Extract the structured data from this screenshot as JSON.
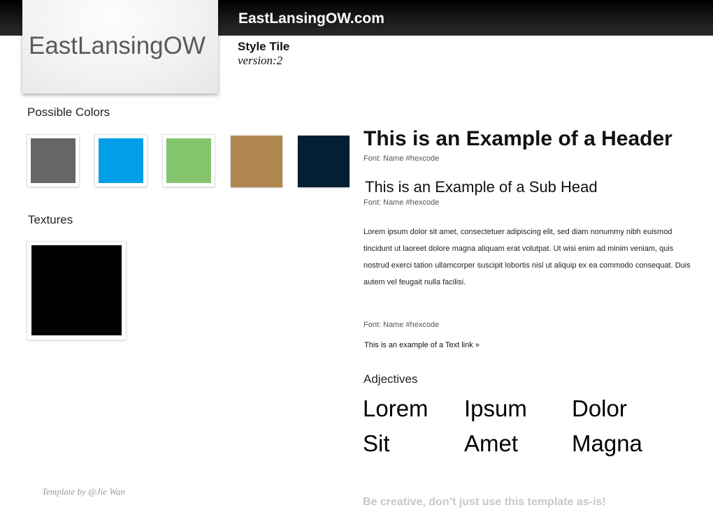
{
  "header": {
    "site_title": "EastLansingOW.com"
  },
  "logo": {
    "text": "EastLansingOW"
  },
  "tile": {
    "title": "Style Tile",
    "version": "version:2"
  },
  "colors": {
    "label": "Possible Colors",
    "swatches": [
      "#666666",
      "#009fe8",
      "#83c46d",
      "#b0864f",
      "#041e33"
    ]
  },
  "textures": {
    "label": "Textures",
    "color": "#000000"
  },
  "typography": {
    "header": "This is an Example of a Header",
    "header_font": "Font: Name #hexcode",
    "subhead": "This is an Example of a Sub Head",
    "subhead_font": "Font: Name #hexcode",
    "body": "Lorem ipsum dolor sit amet, consectetuer adipiscing elit, sed diam nonummy nibh euismod tincidunt ut laoreet dolore magna aliquam erat volutpat. Ut wisi enim ad minim veniam, quis nostrud exerci tation ullamcorper suscipit lobortis nisl ut aliquip ex ea commodo consequat. Duis autem vel feugait nulla facilisi.",
    "link_font": "Font: Name #hexcode",
    "link_text": "This is an example of a Text link »"
  },
  "adjectives": {
    "label": "Adjectives",
    "words": [
      "Lorem",
      "Ipsum",
      "Dolor",
      "Sit",
      "Amet",
      "Magna"
    ]
  },
  "footer": {
    "credit": "Template by @Jie Wan",
    "note": "Be creative, don’t just use this template as-is!"
  }
}
